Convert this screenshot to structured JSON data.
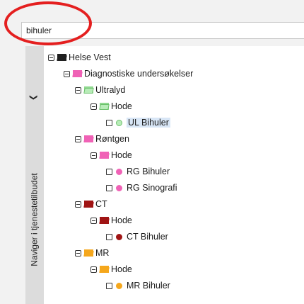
{
  "search": {
    "value": "bihuler",
    "placeholder": ""
  },
  "nav_tab": {
    "label": "Naviger i tjenestetilbudet"
  },
  "colors": {
    "root_folder": "#1f1f1f",
    "ultralyd": "#8fd88f",
    "rontgen": "#f062b6",
    "ct": "#a01414",
    "mr": "#f5a71c",
    "highlight": "#e41f1f",
    "selected_bg": "#d8e6f6"
  },
  "tree": {
    "root": {
      "label": "Helse Vest",
      "icon": "folder-open-icon"
    },
    "diagnostics": {
      "label": "Diagnostiske undersøkelser",
      "icon": "folder-open-icon"
    },
    "ultralyd": {
      "label": "Ultralyd",
      "hode": "Hode",
      "item": {
        "label": "UL Bihuler",
        "status": "green-dot",
        "selected": true
      }
    },
    "rontgen": {
      "label": "Røntgen",
      "hode": "Hode",
      "items": [
        {
          "label": "RG Bihuler",
          "status": "pink-dot"
        },
        {
          "label": "RG Sinografi",
          "status": "pink-dot"
        }
      ]
    },
    "ct": {
      "label": "CT",
      "hode": "Hode",
      "item": {
        "label": "CT Bihuler",
        "status": "red-dot"
      }
    },
    "mr": {
      "label": "MR",
      "hode": "Hode",
      "item": {
        "label": "MR Bihuler",
        "status": "orange-dot"
      }
    }
  }
}
